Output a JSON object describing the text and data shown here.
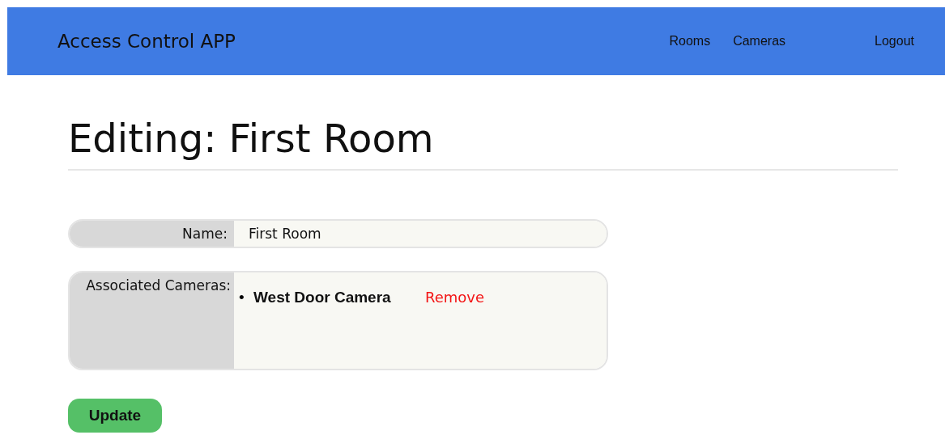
{
  "header": {
    "brand": "Access Control APP",
    "nav": [
      {
        "label": "Rooms"
      },
      {
        "label": "Cameras"
      }
    ],
    "logout": "Logout"
  },
  "page": {
    "title": "Editing: First Room"
  },
  "form": {
    "name_label": "Name:",
    "name_value": "First Room",
    "cameras_label": "Associated Cameras:",
    "cameras": [
      {
        "bullet": "•",
        "name": "West Door Camera",
        "action": "Remove"
      }
    ]
  },
  "submit": "Update"
}
